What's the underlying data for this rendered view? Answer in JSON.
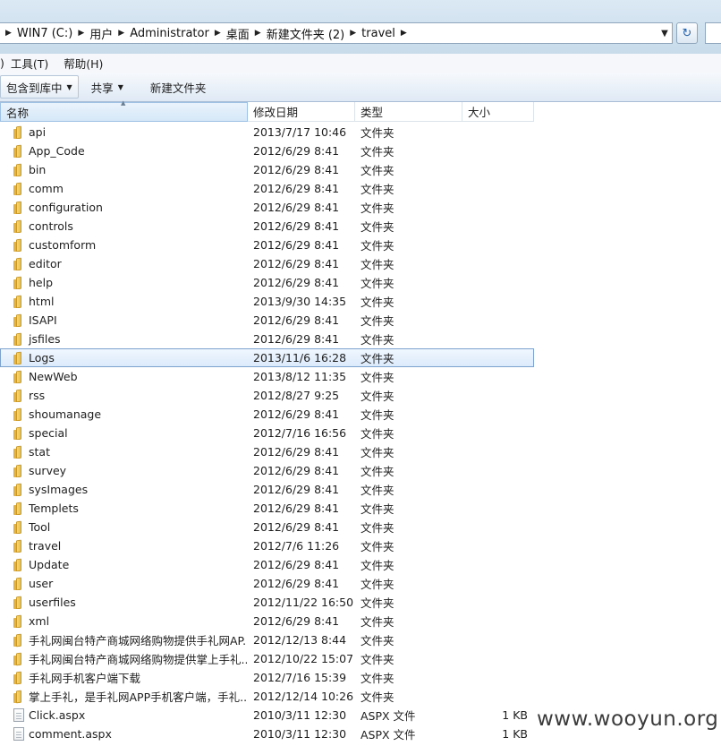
{
  "address": {
    "crumbs": [
      "WIN7 (C:)",
      "用户",
      "Administrator",
      "桌面",
      "新建文件夹 (2)",
      "travel"
    ]
  },
  "menu": [
    "工具(T)",
    "帮助(H)"
  ],
  "toolbar": {
    "include": "包含到库中",
    "share": "共享",
    "new_folder": "新建文件夹"
  },
  "columns": {
    "name": "名称",
    "date": "修改日期",
    "type": "类型",
    "size": "大小"
  },
  "files": [
    {
      "name": "api",
      "date": "2013/7/17 10:46",
      "type": "文件夹",
      "size": "",
      "kind": "folder"
    },
    {
      "name": "App_Code",
      "date": "2012/6/29 8:41",
      "type": "文件夹",
      "size": "",
      "kind": "folder"
    },
    {
      "name": "bin",
      "date": "2012/6/29 8:41",
      "type": "文件夹",
      "size": "",
      "kind": "folder"
    },
    {
      "name": "comm",
      "date": "2012/6/29 8:41",
      "type": "文件夹",
      "size": "",
      "kind": "folder"
    },
    {
      "name": "configuration",
      "date": "2012/6/29 8:41",
      "type": "文件夹",
      "size": "",
      "kind": "folder"
    },
    {
      "name": "controls",
      "date": "2012/6/29 8:41",
      "type": "文件夹",
      "size": "",
      "kind": "folder"
    },
    {
      "name": "customform",
      "date": "2012/6/29 8:41",
      "type": "文件夹",
      "size": "",
      "kind": "folder"
    },
    {
      "name": "editor",
      "date": "2012/6/29 8:41",
      "type": "文件夹",
      "size": "",
      "kind": "folder"
    },
    {
      "name": "help",
      "date": "2012/6/29 8:41",
      "type": "文件夹",
      "size": "",
      "kind": "folder"
    },
    {
      "name": "html",
      "date": "2013/9/30 14:35",
      "type": "文件夹",
      "size": "",
      "kind": "folder"
    },
    {
      "name": "ISAPI",
      "date": "2012/6/29 8:41",
      "type": "文件夹",
      "size": "",
      "kind": "folder"
    },
    {
      "name": "jsfiles",
      "date": "2012/6/29 8:41",
      "type": "文件夹",
      "size": "",
      "kind": "folder"
    },
    {
      "name": "Logs",
      "date": "2013/11/6 16:28",
      "type": "文件夹",
      "size": "",
      "kind": "folder",
      "selected": true
    },
    {
      "name": "NewWeb",
      "date": "2013/8/12 11:35",
      "type": "文件夹",
      "size": "",
      "kind": "folder"
    },
    {
      "name": "rss",
      "date": "2012/8/27 9:25",
      "type": "文件夹",
      "size": "",
      "kind": "folder"
    },
    {
      "name": "shoumanage",
      "date": "2012/6/29 8:41",
      "type": "文件夹",
      "size": "",
      "kind": "folder"
    },
    {
      "name": "special",
      "date": "2012/7/16 16:56",
      "type": "文件夹",
      "size": "",
      "kind": "folder"
    },
    {
      "name": "stat",
      "date": "2012/6/29 8:41",
      "type": "文件夹",
      "size": "",
      "kind": "folder"
    },
    {
      "name": "survey",
      "date": "2012/6/29 8:41",
      "type": "文件夹",
      "size": "",
      "kind": "folder"
    },
    {
      "name": "sysImages",
      "date": "2012/6/29 8:41",
      "type": "文件夹",
      "size": "",
      "kind": "folder"
    },
    {
      "name": "Templets",
      "date": "2012/6/29 8:41",
      "type": "文件夹",
      "size": "",
      "kind": "folder"
    },
    {
      "name": "Tool",
      "date": "2012/6/29 8:41",
      "type": "文件夹",
      "size": "",
      "kind": "folder"
    },
    {
      "name": "travel",
      "date": "2012/7/6 11:26",
      "type": "文件夹",
      "size": "",
      "kind": "folder"
    },
    {
      "name": "Update",
      "date": "2012/6/29 8:41",
      "type": "文件夹",
      "size": "",
      "kind": "folder"
    },
    {
      "name": "user",
      "date": "2012/6/29 8:41",
      "type": "文件夹",
      "size": "",
      "kind": "folder"
    },
    {
      "name": "userfiles",
      "date": "2012/11/22 16:50",
      "type": "文件夹",
      "size": "",
      "kind": "folder"
    },
    {
      "name": "xml",
      "date": "2012/6/29 8:41",
      "type": "文件夹",
      "size": "",
      "kind": "folder"
    },
    {
      "name": "手礼网闽台特产商城网络购物提供手礼网AP...",
      "date": "2012/12/13 8:44",
      "type": "文件夹",
      "size": "",
      "kind": "folder"
    },
    {
      "name": "手礼网闽台特产商城网络购物提供掌上手礼...",
      "date": "2012/10/22 15:07",
      "type": "文件夹",
      "size": "",
      "kind": "folder"
    },
    {
      "name": "手礼网手机客户端下载",
      "date": "2012/7/16 15:39",
      "type": "文件夹",
      "size": "",
      "kind": "folder"
    },
    {
      "name": "掌上手礼，是手礼网APP手机客户端，手礼...",
      "date": "2012/12/14 10:26",
      "type": "文件夹",
      "size": "",
      "kind": "folder"
    },
    {
      "name": "Click.aspx",
      "date": "2010/3/11 12:30",
      "type": "ASPX 文件",
      "size": "1 KB",
      "kind": "file"
    },
    {
      "name": "comment.aspx",
      "date": "2010/3/11 12:30",
      "type": "ASPX 文件",
      "size": "1 KB",
      "kind": "file"
    }
  ],
  "watermark": "www.wooyun.org"
}
